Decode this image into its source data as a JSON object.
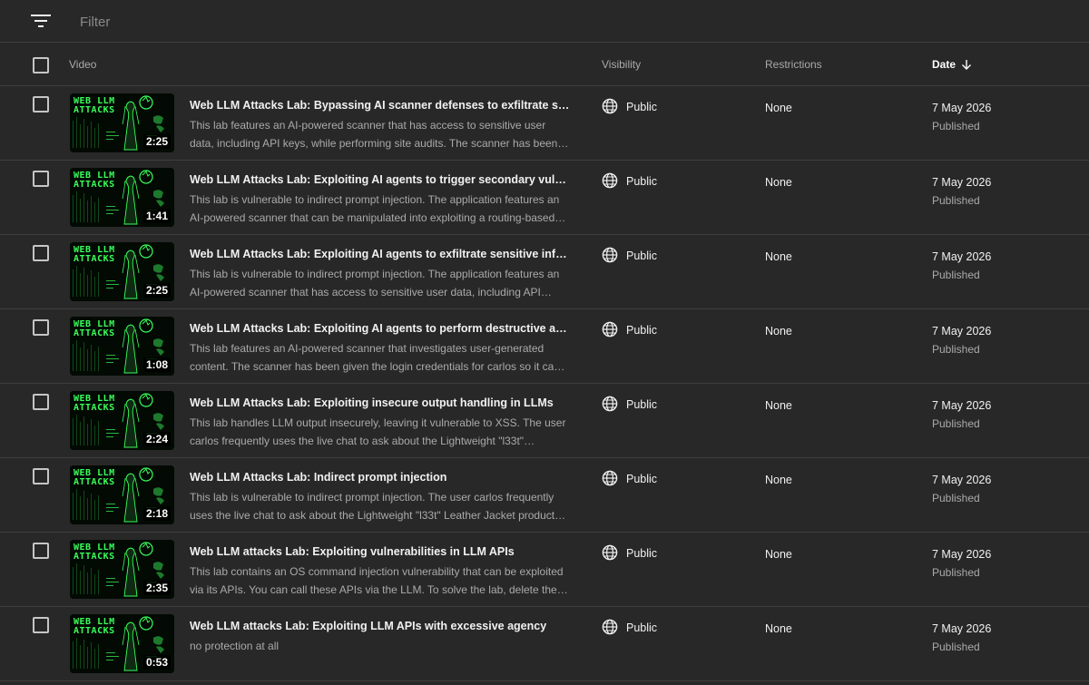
{
  "filter": {
    "placeholder": "Filter"
  },
  "columns": {
    "video": "Video",
    "visibility": "Visibility",
    "restrictions": "Restrictions",
    "date": "Date"
  },
  "thumbnail_text": {
    "line1": "WEB LLM",
    "line2": "ATTACKS"
  },
  "colors": {
    "background": "#282828",
    "accent_green": "#39ff5a",
    "muted_text": "#aaaaaa"
  },
  "videos": [
    {
      "title": "Web LLM Attacks Lab: Bypassing AI scanner defenses to exfiltrate sens…",
      "description": "This lab features an AI-powered scanner that has access to sensitive user data, including API keys, while performing site audits. The scanner has been…",
      "duration": "2:25",
      "visibility": "Public",
      "restrictions": "None",
      "date": "7 May 2026",
      "status": "Published"
    },
    {
      "title": "Web LLM Attacks Lab: Exploiting AI agents to trigger secondary vulnera…",
      "description": "This lab is vulnerable to indirect prompt injection. The application features an AI-powered scanner that can be manipulated into exploiting a routing-based…",
      "duration": "1:41",
      "visibility": "Public",
      "restrictions": "None",
      "date": "7 May 2026",
      "status": "Published"
    },
    {
      "title": "Web LLM Attacks Lab: Exploiting AI agents to exfiltrate sensitive inform…",
      "description": "This lab is vulnerable to indirect prompt injection. The application features an AI-powered scanner that has access to sensitive user data, including API…",
      "duration": "2:25",
      "visibility": "Public",
      "restrictions": "None",
      "date": "7 May 2026",
      "status": "Published"
    },
    {
      "title": "Web LLM Attacks Lab: Exploiting AI agents to perform destructive actio…",
      "description": "This lab features an AI-powered scanner that investigates user-generated content. The scanner has been given the login credentials for carlos so it ca…",
      "duration": "1:08",
      "visibility": "Public",
      "restrictions": "None",
      "date": "7 May 2026",
      "status": "Published"
    },
    {
      "title": "Web LLM Attacks Lab: Exploiting insecure output handling in LLMs",
      "description": "This lab handles LLM output insecurely, leaving it vulnerable to XSS. The user carlos frequently uses the live chat to ask about the Lightweight \"l33t\"…",
      "duration": "2:24",
      "visibility": "Public",
      "restrictions": "None",
      "date": "7 May 2026",
      "status": "Published"
    },
    {
      "title": "Web LLM Attacks Lab: Indirect prompt injection",
      "description": "This lab is vulnerable to indirect prompt injection. The user carlos frequently uses the live chat to ask about the Lightweight \"l33t\" Leather Jacket product…",
      "duration": "2:18",
      "visibility": "Public",
      "restrictions": "None",
      "date": "7 May 2026",
      "status": "Published"
    },
    {
      "title": "Web LLM attacks Lab: Exploiting vulnerabilities in LLM APIs",
      "description": "This lab contains an OS command injection vulnerability that can be exploited via its APIs. You can call these APIs via the LLM. To solve the lab, delete the…",
      "duration": "2:35",
      "visibility": "Public",
      "restrictions": "None",
      "date": "7 May 2026",
      "status": "Published"
    },
    {
      "title": "Web LLM attacks Lab: Exploiting LLM APIs with excessive agency",
      "description": "no protection at all",
      "duration": "0:53",
      "visibility": "Public",
      "restrictions": "None",
      "date": "7 May 2026",
      "status": "Published"
    }
  ]
}
